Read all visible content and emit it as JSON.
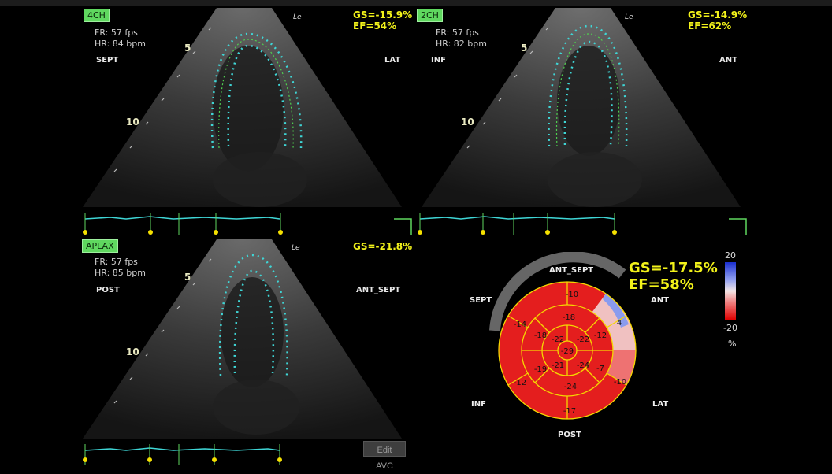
{
  "views": [
    {
      "label": "4CH",
      "fr": "FR: 57 fps",
      "hr": "HR: 84 bpm",
      "wall_left": "SEPT",
      "wall_right": "LAT",
      "gs": "GS=-15.9%",
      "ef": "EF=54%",
      "depth5": "5",
      "depth10": "10",
      "le": "Le"
    },
    {
      "label": "2CH",
      "fr": "FR: 57 fps",
      "hr": "HR: 82 bpm",
      "wall_left": "INF",
      "wall_right": "ANT",
      "gs": "GS=-14.9%",
      "ef": "EF=62%",
      "depth5": "5",
      "depth10": "10",
      "le": "Le"
    },
    {
      "label": "APLAX",
      "fr": "FR: 57 fps",
      "hr": "HR: 85 bpm",
      "wall_left": "POST",
      "wall_right": "ANT_SEPT",
      "gs": "GS=-21.8%",
      "depth5": "5",
      "depth10": "10",
      "le": "Le"
    }
  ],
  "bullseye": {
    "gs": "GS=-17.5%",
    "ef": "EF=58%",
    "walls": {
      "ant_sept": "ANT_SEPT",
      "sept": "SEPT",
      "ant": "ANT",
      "inf": "INF",
      "lat": "LAT",
      "post": "POST"
    },
    "segments": {
      "basal": [
        "-10",
        "4",
        "-10",
        "-17",
        "-12",
        "-14"
      ],
      "mid": [
        "-18",
        "-12",
        "-7",
        "-24",
        "-19",
        "-18"
      ],
      "apical": [
        "-22",
        "-22",
        "-24",
        "-21"
      ],
      "apex": "-29"
    },
    "scale": {
      "max": "20",
      "min": "-20",
      "unit": "%"
    },
    "colors": {
      "red": "#e41e1e",
      "blue": "#8a9bee",
      "line": "#f5d800"
    }
  },
  "edit_button": "Edit AVC"
}
